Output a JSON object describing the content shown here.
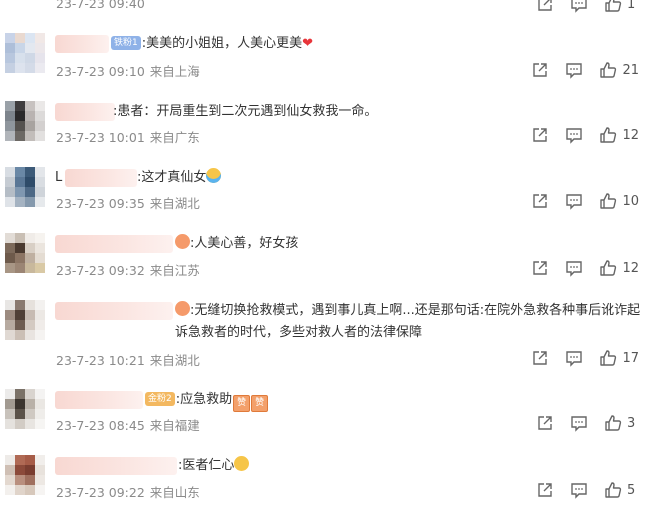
{
  "comments": [
    {
      "text": "",
      "time": "23-7-23 09:40",
      "location": "",
      "likes": "1"
    },
    {
      "badge": "铁粉1",
      "text": ":美美的小姐姐，人美心更美",
      "time": "23-7-23 09:10",
      "location": "来自上海",
      "likes": "21"
    },
    {
      "text": ":患者：开局重生到二次元遇到仙女救我一命。",
      "time": "23-7-23 10:01",
      "location": "来自广东",
      "likes": "12"
    },
    {
      "name_prefix": "L",
      "text": ":这才真仙女",
      "time": "23-7-23 09:35",
      "location": "来自湖北",
      "likes": "10"
    },
    {
      "text": ":人美心善，好女孩",
      "time": "23-7-23 09:32",
      "location": "来自江苏",
      "likes": "12"
    },
    {
      "text": ":无缝切换抢救模式，遇到事儿真上啊...还是那句话:在院外急救各种事后讹诈起诉急救者的时代，多些对救人者的法律保障",
      "time": "23-7-23 10:21",
      "location": "来自湖北",
      "likes": "17"
    },
    {
      "badge": "金粉2",
      "text": ":应急救助",
      "seal_text": "赞",
      "time": "23-7-23 08:45",
      "location": "来自福建",
      "likes": "3"
    },
    {
      "text": ":医者仁心",
      "time": "23-7-23 09:22",
      "location": "来自山东",
      "likes": "5"
    }
  ],
  "colors": {
    "meta": "#8a8a8a",
    "text": "#333333",
    "icon": "#666666",
    "heart": "#e8353a"
  },
  "icons": [
    "share-icon",
    "comment-icon",
    "like-icon"
  ]
}
